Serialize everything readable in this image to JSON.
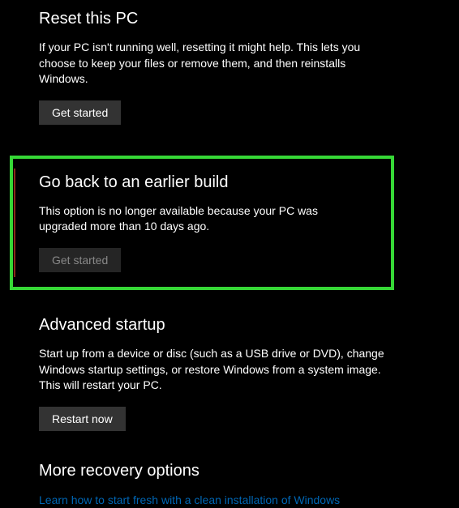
{
  "reset": {
    "title": "Reset this PC",
    "desc": "If your PC isn't running well, resetting it might help. This lets you choose to keep your files or remove them, and then reinstalls Windows.",
    "button": "Get started"
  },
  "goback": {
    "title": "Go back to an earlier build",
    "desc": "This option is no longer available because your PC was upgraded more than 10 days ago.",
    "button": "Get started"
  },
  "advanced": {
    "title": "Advanced startup",
    "desc": "Start up from a device or disc (such as a USB drive or DVD), change Windows startup settings, or restore Windows from a system image. This will restart your PC.",
    "button": "Restart now"
  },
  "more": {
    "title": "More recovery options",
    "link": "Learn how to start fresh with a clean installation of Windows"
  }
}
